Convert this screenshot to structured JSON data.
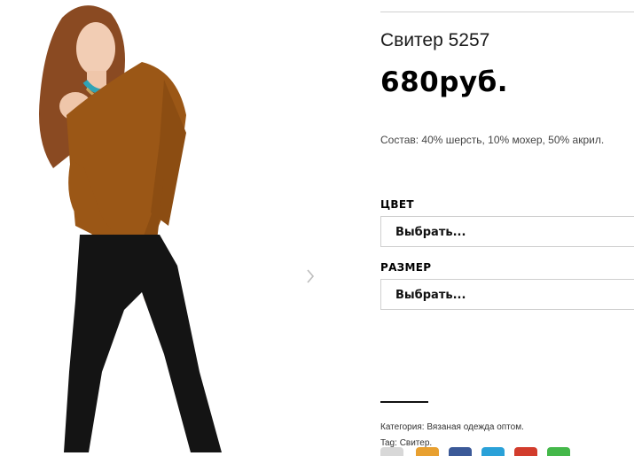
{
  "product": {
    "title": "Свитер 5257",
    "price": "680руб.",
    "composition": "Состав: 40% шерсть, 10% мохер, 50% акрил."
  },
  "attributes": [
    {
      "label": "ЦВЕТ",
      "select_value": "Выбрать..."
    },
    {
      "label": "РАЗМЕР",
      "select_value": "Выбрать..."
    }
  ],
  "meta": {
    "category_label": "Категория:",
    "category_value": "Вязаная одежда оптом.",
    "tag_label": "Tag:",
    "tag_value": "Свитер."
  },
  "gallery": {
    "next_icon": "chevron-right-icon"
  },
  "share_colors": [
    "#d8d8d8",
    "#e8a030",
    "#3b5998",
    "#2aa1d8",
    "#d23c2c",
    "#44b84a"
  ]
}
